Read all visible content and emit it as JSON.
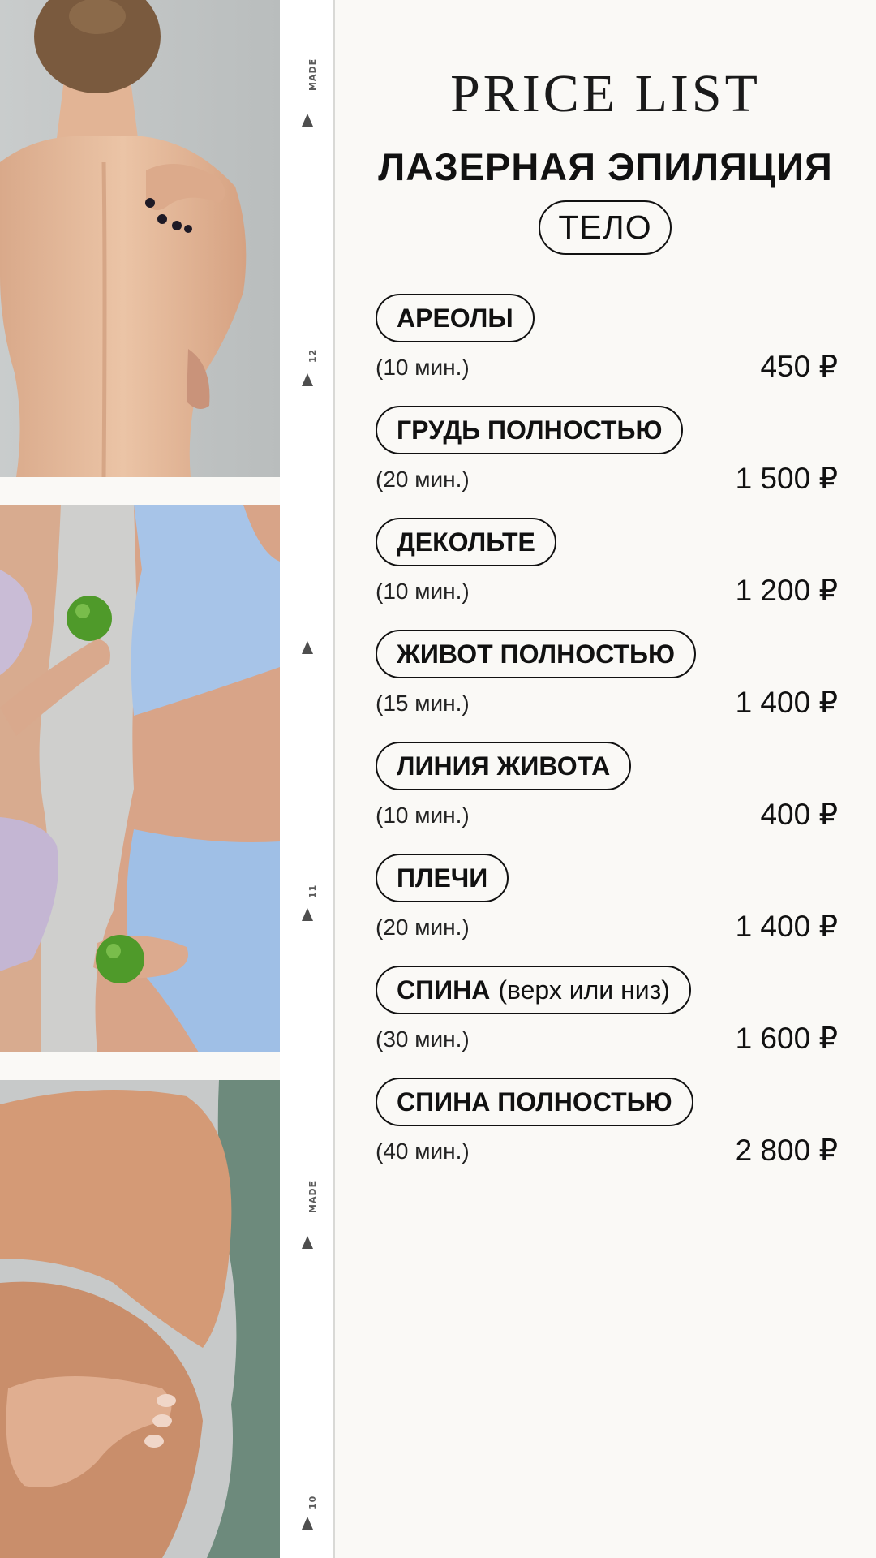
{
  "page": {
    "title": "PRICE LIST",
    "subtitle": "ЛАЗЕРНАЯ ЭПИЛЯЦИЯ",
    "section": "ТЕЛО"
  },
  "film_strip": {
    "marks": [
      "MADE",
      "12",
      "",
      "11",
      "MADE",
      "10"
    ]
  },
  "services": [
    {
      "name": "АРЕОЛЫ",
      "note": "",
      "duration": "(10 мин.)",
      "price": "450 ₽"
    },
    {
      "name": "ГРУДЬ ПОЛНОСТЬЮ",
      "note": "",
      "duration": "(20 мин.)",
      "price": "1 500 ₽"
    },
    {
      "name": "ДЕКОЛЬТЕ",
      "note": "",
      "duration": "(10 мин.)",
      "price": "1 200 ₽"
    },
    {
      "name": "ЖИВОТ ПОЛНОСТЬЮ",
      "note": "",
      "duration": "(15 мин.)",
      "price": "1 400 ₽"
    },
    {
      "name": "ЛИНИЯ ЖИВОТА",
      "note": "",
      "duration": "(10 мин.)",
      "price": "400 ₽"
    },
    {
      "name": "ПЛЕЧИ",
      "note": "",
      "duration": "(20 мин.)",
      "price": "1 400 ₽"
    },
    {
      "name": "СПИНА",
      "note": "(верх или низ)",
      "duration": "(30 мин.)",
      "price": "1 600 ₽"
    },
    {
      "name": "СПИНА ПОЛНОСТЬЮ",
      "note": "",
      "duration": "(40 мин.)",
      "price": "2 800 ₽"
    }
  ],
  "colors": {
    "background": "#faf9f6",
    "text": "#161616",
    "pill_border": "#111111"
  }
}
